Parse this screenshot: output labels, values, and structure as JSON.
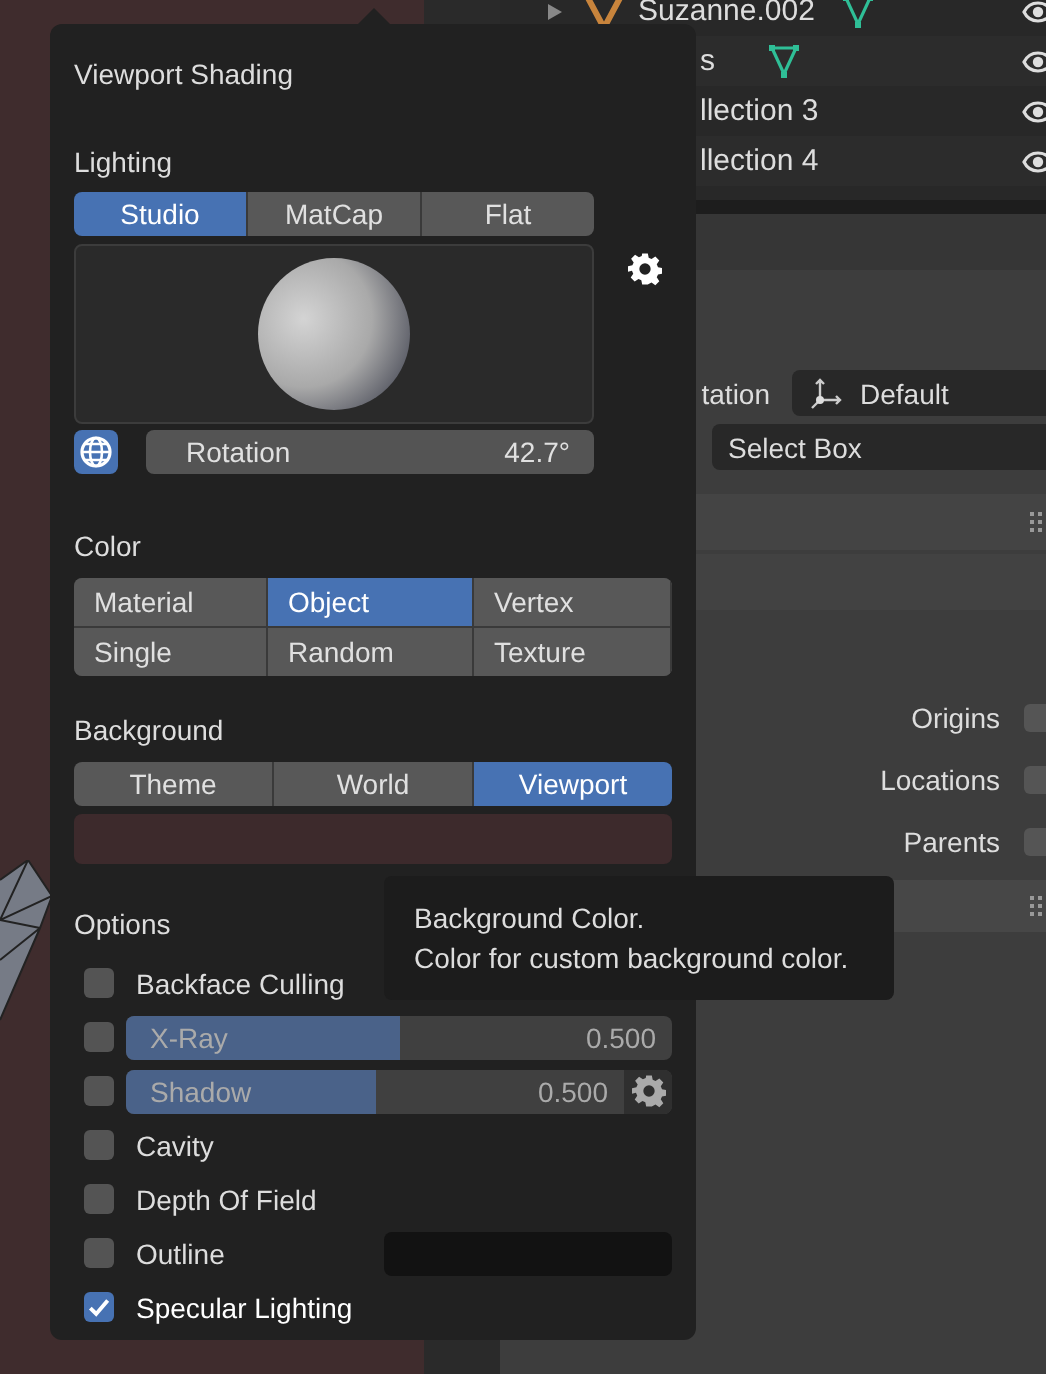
{
  "outliner": {
    "rows": [
      {
        "kind": "object",
        "name": "Suzanne.002",
        "covered": false
      },
      {
        "kind": "object",
        "name": "s",
        "covered": true
      },
      {
        "kind": "collection",
        "name": "llection 3",
        "covered": true
      },
      {
        "kind": "collection",
        "name": "llection 4",
        "covered": true
      }
    ]
  },
  "tool_settings": {
    "fields": [
      {
        "label": "tation",
        "value": "Default",
        "kind": "orientation"
      },
      {
        "value": "Select Box",
        "kind": "plain"
      }
    ],
    "toggles": [
      {
        "label": "Origins",
        "checked": false
      },
      {
        "label": "Locations",
        "checked": false
      },
      {
        "label": "Parents",
        "checked": false
      }
    ]
  },
  "popup": {
    "title": "Viewport Shading",
    "lighting": {
      "label": "Lighting",
      "options": [
        {
          "label": "Studio",
          "selected": true
        },
        {
          "label": "MatCap",
          "selected": false
        },
        {
          "label": "Flat",
          "selected": false
        }
      ],
      "world_space_on": true,
      "rotation": {
        "label": "Rotation",
        "value": "42.7°"
      }
    },
    "color": {
      "label": "Color",
      "options": [
        {
          "label": "Material",
          "selected": false
        },
        {
          "label": "Object",
          "selected": true
        },
        {
          "label": "Vertex",
          "selected": false
        },
        {
          "label": "Single",
          "selected": false
        },
        {
          "label": "Random",
          "selected": false
        },
        {
          "label": "Texture",
          "selected": false
        }
      ]
    },
    "background": {
      "label": "Background",
      "options": [
        {
          "label": "Theme",
          "selected": false
        },
        {
          "label": "World",
          "selected": false
        },
        {
          "label": "Viewport",
          "selected": true
        }
      ]
    },
    "options": {
      "label": "Options",
      "rows": [
        {
          "kind": "checkbox",
          "label": "Backface Culling",
          "checked": false
        },
        {
          "kind": "slider",
          "label": "X-Ray",
          "checked": false,
          "level": 0.5,
          "value": "0.500"
        },
        {
          "kind": "slider_gear",
          "label": "Shadow",
          "checked": false,
          "level": 0.5,
          "value": "0.500"
        },
        {
          "kind": "checkbox",
          "label": "Cavity",
          "checked": false
        },
        {
          "kind": "checkbox",
          "label": "Depth Of Field",
          "checked": false
        },
        {
          "kind": "swatch",
          "label": "Outline",
          "checked": false
        },
        {
          "kind": "checkbox",
          "label": "Specular Lighting",
          "checked": true
        }
      ]
    }
  },
  "tooltip": {
    "title": "Background Color.",
    "text": "Color for custom background color."
  }
}
